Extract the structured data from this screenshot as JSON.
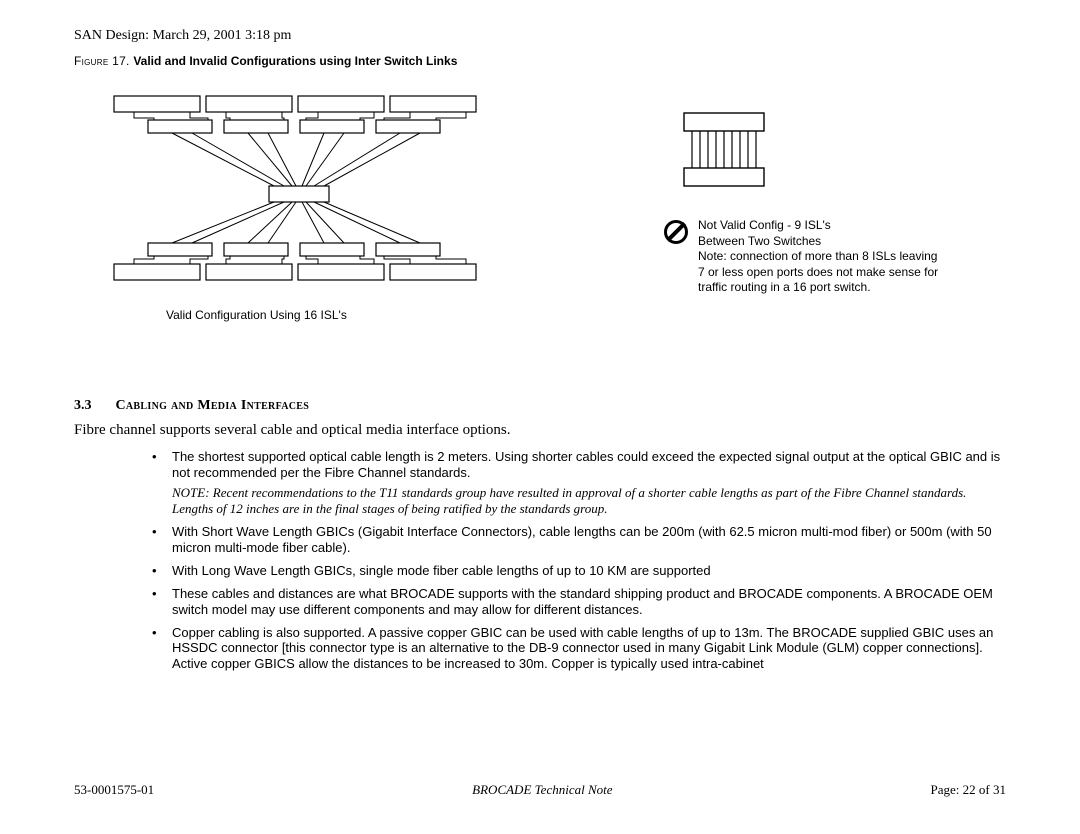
{
  "header": {
    "title_line": "SAN Design:  March 29, 2001 3:18 pm"
  },
  "figure": {
    "label_pre": "Figure  17. ",
    "label_bold": "Valid and Invalid Configurations using Inter Switch Links",
    "valid_caption": "Valid Configuration Using 16 ISL's",
    "invalid": {
      "l1": "Not Valid Config - 9 ISL's",
      "l2": "Between Two Switches",
      "l3": "Note: connection of more than 8 ISLs leaving",
      "l4": "7 or less open ports does not make sense for",
      "l5": "traffic routing in a 16 port switch."
    }
  },
  "section": {
    "num": "3.3",
    "title": "Cabling and Media Interfaces",
    "intro": "Fibre channel supports several cable and optical media interface options.",
    "bullets": [
      {
        "text": "The shortest supported optical cable length is 2 meters. Using shorter cables could exceed the expected signal output at the optical GBIC and is not recommended per the Fibre Channel standards.",
        "note": "NOTE:  Recent recommendations to the T11 standards group have resulted in approval of a shorter cable lengths as part of the Fibre Channel standards. Lengths of 12 inches are in the final stages of being ratified by the standards group."
      },
      {
        "text": "With Short Wave Length GBICs (Gigabit Interface Connectors), cable lengths can be 200m (with 62.5 micron multi-mod fiber) or 500m (with 50 micron multi-mode fiber cable)."
      },
      {
        "text": "With Long Wave Length GBICs, single mode fiber cable lengths of up to 10 KM are supported"
      },
      {
        "text": "These cables and distances are what BROCADE supports with the standard shipping product and BROCADE components. A BROCADE OEM switch model may use different components and may allow for different distances."
      },
      {
        "text": "Copper cabling is also supported. A passive copper GBIC can be used with cable lengths of up to 13m. The BROCADE supplied GBIC uses an HSSDC connector [this connector type is an alternative to the DB-9 connector used in many Gigabit Link Module (GLM) copper connections]. Active copper GBICS allow the distances to be increased to 30m. Copper is typically used intra-cabinet"
      }
    ]
  },
  "footer": {
    "left": "53-0001575-01",
    "mid": "BROCADE Technical Note",
    "right": "Page:   22 of 31"
  }
}
